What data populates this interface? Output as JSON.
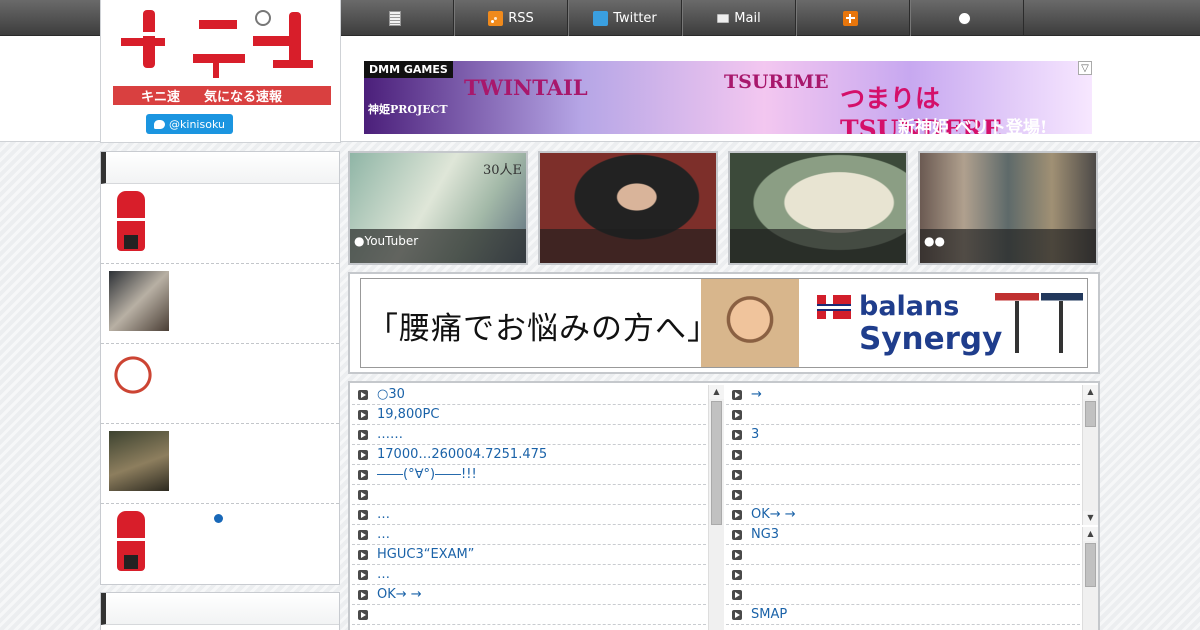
{
  "nav": {
    "items": [
      {
        "label": "",
        "icon": "document-icon"
      },
      {
        "label": "RSS",
        "icon": "rss-icon"
      },
      {
        "label": "Twitter",
        "icon": "twitter-icon"
      },
      {
        "label": "Mail",
        "icon": "mail-icon"
      },
      {
        "label": "",
        "icon": "kani-icon"
      },
      {
        "label": "",
        "icon": "face-icon"
      }
    ]
  },
  "logo": {
    "name": "キニ速",
    "tagline": "気になる速報",
    "follow_label": "@kinisoku"
  },
  "top_banner": {
    "network": "DMM GAMES",
    "word1": "TWINTAIL",
    "word2": "TSURIME",
    "word3": "つまりはTSUNDERE",
    "word4": "新神姫 ベリト登場!",
    "game_tag": "神姫PROJECT",
    "ad_choice": "▽"
  },
  "sidebar": {
    "items": [
      {
        "thumb": "tenga",
        "text": ""
      },
      {
        "thumb": "photo",
        "text": ""
      },
      {
        "thumb": "cake",
        "text": ""
      },
      {
        "thumb": "snake",
        "text": ""
      },
      {
        "thumb": "tenga",
        "text": "",
        "dot": true
      }
    ]
  },
  "cards": [
    {
      "caption": "●YouTuber",
      "overlay": "30人E"
    },
    {
      "caption": ""
    },
    {
      "caption": ""
    },
    {
      "caption": "●●"
    }
  ],
  "mid_ad": {
    "headline": "「腰痛でお悩みの方へ」",
    "brand_line1": "balans",
    "brand_line2": "Synergy"
  },
  "lists": {
    "left": [
      "○30",
      "19,800PC",
      "……",
      "17000…260004.7251.475",
      "――(°∀°)――!!!",
      "",
      "…",
      "…",
      "HGUC3“EXAM”",
      "…",
      "OK→ →",
      "",
      ""
    ],
    "right": [
      "→",
      "",
      "3",
      "",
      "",
      "",
      "OK→ →",
      "NG3",
      "",
      "",
      "",
      "SMAP",
      ""
    ]
  }
}
